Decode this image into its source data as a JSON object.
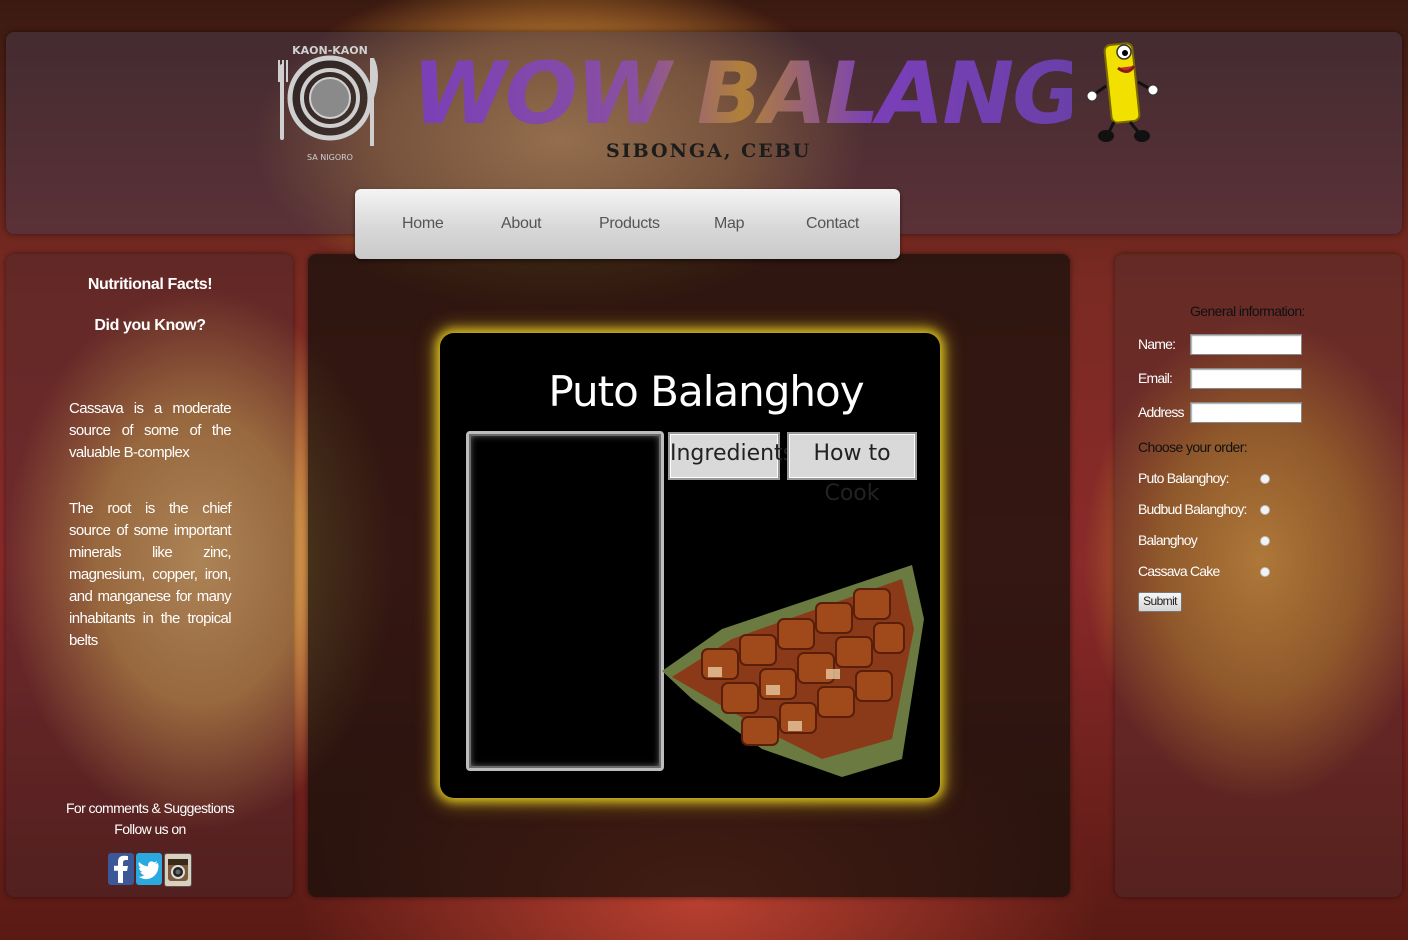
{
  "header": {
    "logo_text_top": "KAON-KAON",
    "logo_text_bottom": "SA NIGORO",
    "brand_title": "WOW BALANGHOY!",
    "brand_subtitle": "SIBONGA, CEBU"
  },
  "nav": {
    "items": [
      "Home",
      "About",
      "Products",
      "Map",
      "Contact"
    ]
  },
  "left": {
    "nutrition_title": "Nutritional Facts!",
    "did_you_know_title": "Did you Know?",
    "fact1": "Cassava is a moderate source of some of the valuable B-complex",
    "fact2": "The root is the chief source of some important minerals like zinc, magnesium, copper, iron, and manganese for many inhabitants in the tropical belts",
    "comments_line1": "For comments & Suggestions",
    "comments_line2": "Follow us on",
    "socials": [
      "facebook-icon",
      "twitter-icon",
      "instagram-icon"
    ]
  },
  "product": {
    "title": "Puto Balanghoy",
    "ingredients_label": "Ingredients",
    "how_to_cook_label": "How to Cook"
  },
  "form": {
    "general_info": "General information:",
    "name_label": "Name:",
    "email_label": "Email:",
    "address_label": "Address",
    "choose_label": "Choose your order:",
    "options": [
      "Puto Balanghoy:",
      "Budbud Balanghoy:",
      "Balanghoy",
      "Cassava Cake"
    ],
    "submit_label": "Submit"
  }
}
